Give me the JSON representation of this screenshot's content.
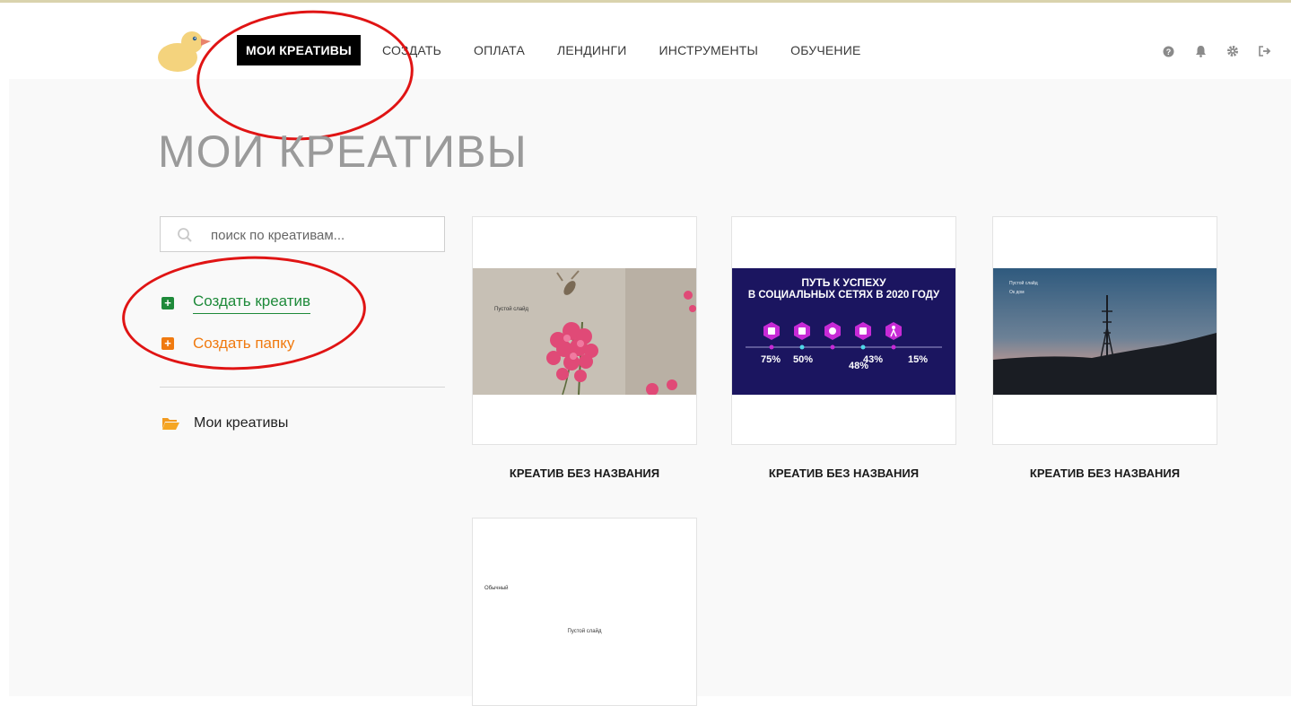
{
  "nav": {
    "items": [
      {
        "label": "МОИ КРЕАТИВЫ",
        "active": true
      },
      {
        "label": "СОЗДАТЬ",
        "active": false
      },
      {
        "label": "ОПЛАТА",
        "active": false
      },
      {
        "label": "ЛЕНДИНГИ",
        "active": false
      },
      {
        "label": "ИНСТРУМЕНТЫ",
        "active": false
      },
      {
        "label": "ОБУЧЕНИЕ",
        "active": false
      }
    ],
    "icons": [
      "help-icon",
      "bell-icon",
      "gear-icon",
      "logout-icon"
    ]
  },
  "page": {
    "title": "МОИ КРЕАТИВЫ"
  },
  "sidebar": {
    "search_placeholder": "поиск по креативам...",
    "create_creative": "Создать креатив",
    "create_folder": "Создать папку",
    "folder_label": "Мои креативы"
  },
  "cards": [
    {
      "title": "КРЕАТИВ БЕЗ НАЗВАНИЯ",
      "slide_text": "Пустой слайд"
    },
    {
      "title": "КРЕАТИВ БЕЗ НАЗВАНИЯ",
      "heading_line1": "ПУТЬ К УСПЕХУ",
      "heading_line2": "В СОЦИАЛЬНЫХ СЕТЯХ В 2020 ГОДУ",
      "stats": [
        "75%",
        "50%",
        "48%",
        "43%",
        "15%"
      ]
    },
    {
      "title": "КРЕАТИВ БЕЗ НАЗВАНИЯ",
      "slide_text": "Пустой слайд",
      "slide_subtext": "Ок дом"
    },
    {
      "title": "",
      "slide_label": "Обычный",
      "slide_text": "Пустой слайд"
    }
  ],
  "colors": {
    "green": "#1e8a3a",
    "orange": "#f07a10",
    "annotation_red": "#e01414",
    "infographic_bg": "#1b1560",
    "infographic_accent": "#c72ad6"
  }
}
